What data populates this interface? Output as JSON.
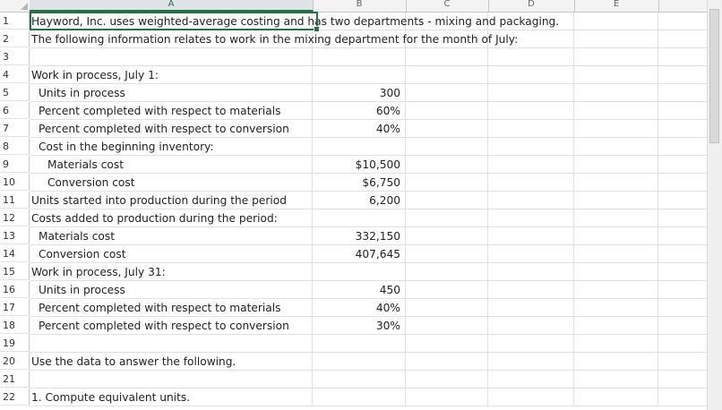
{
  "columns": [
    "A",
    "B",
    "C",
    "D",
    "E"
  ],
  "rows": [
    {
      "num": "1",
      "a": "Hayword, Inc. uses weighted-average costing and has two departments - mixing and packaging.",
      "b": "",
      "indent": 0
    },
    {
      "num": "2",
      "a": "The following information relates to work in the mixing department for the month of July:",
      "b": "",
      "indent": 0
    },
    {
      "num": "3",
      "a": "",
      "b": "",
      "indent": 0
    },
    {
      "num": "4",
      "a": "Work in process, July 1:",
      "b": "",
      "indent": 0
    },
    {
      "num": "5",
      "a": "Units in process",
      "b": "300",
      "indent": 1
    },
    {
      "num": "6",
      "a": "Percent completed with respect to materials",
      "b": "60%",
      "indent": 1
    },
    {
      "num": "7",
      "a": "Percent completed with respect to conversion",
      "b": "40%",
      "indent": 1
    },
    {
      "num": "8",
      "a": "Cost in the beginning inventory:",
      "b": "",
      "indent": 1
    },
    {
      "num": "9",
      "a": "Materials cost",
      "b": "$10,500",
      "indent": 2
    },
    {
      "num": "10",
      "a": "Conversion cost",
      "b": "$6,750",
      "indent": 2
    },
    {
      "num": "11",
      "a": "Units started into production during the period",
      "b": "6,200",
      "indent": 0
    },
    {
      "num": "12",
      "a": "Costs added to production during the period:",
      "b": "",
      "indent": 0
    },
    {
      "num": "13",
      "a": "Materials cost",
      "b": "332,150",
      "indent": 1
    },
    {
      "num": "14",
      "a": "Conversion cost",
      "b": "407,645",
      "indent": 1
    },
    {
      "num": "15",
      "a": "Work in process, July 31:",
      "b": "",
      "indent": 0
    },
    {
      "num": "16",
      "a": "Units in process",
      "b": "450",
      "indent": 1
    },
    {
      "num": "17",
      "a": "Percent completed with respect to materials",
      "b": "40%",
      "indent": 1
    },
    {
      "num": "18",
      "a": "Percent completed with respect to conversion",
      "b": "30%",
      "indent": 1
    },
    {
      "num": "19",
      "a": "",
      "b": "",
      "indent": 0
    },
    {
      "num": "20",
      "a": "Use the data to answer the following.",
      "b": "",
      "indent": 0
    },
    {
      "num": "21",
      "a": "",
      "b": "",
      "indent": 0
    },
    {
      "num": "22",
      "a": "1. Compute equivalent units.",
      "b": "",
      "indent": 0
    }
  ],
  "colors": {
    "selection": "#217346",
    "grid": "#e2e2e2",
    "header_bg": "#f3f3f3"
  }
}
